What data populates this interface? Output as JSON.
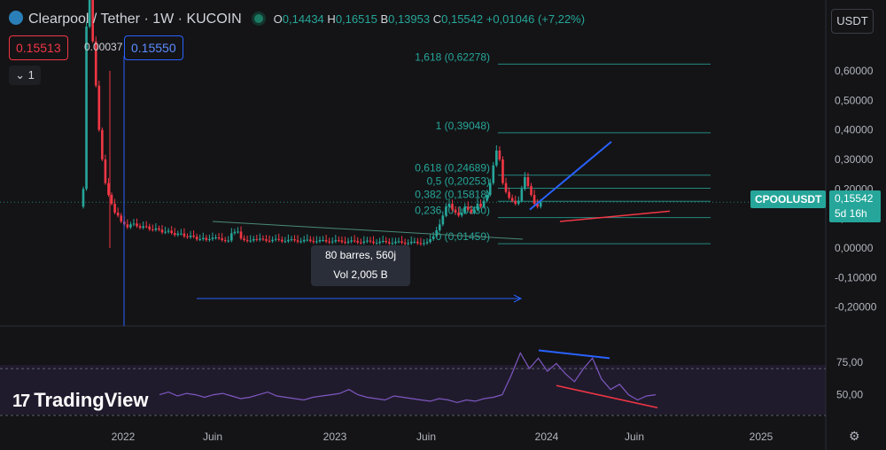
{
  "header": {
    "title": "Clearpool / Tether · 1W · KUCOIN",
    "o_label": "O",
    "o_value": "0,14434",
    "h_label": "H",
    "h_value": "0,16515",
    "l_label": "B",
    "l_value": "0,13953",
    "c_label": "C",
    "c_value": "0,15542",
    "change": "+0,01046 (+7,22%)"
  },
  "trade": {
    "sell": "0.15513",
    "spread": "0.00037",
    "buy": "0.15550"
  },
  "layout_count": "1",
  "currency": "USDT",
  "tooltip": {
    "line1": "80 barres, 560j",
    "line2": "Vol 2,005 B"
  },
  "price_tag": {
    "symbol": "CPOOLUSDT",
    "price": "0,15542",
    "countdown": "5d 16h"
  },
  "branding": {
    "logo": "TradingView"
  },
  "colors": {
    "up": "#26a69a",
    "down": "#f23645",
    "fib": "#26a69a",
    "trend_blue": "#2962ff",
    "rsi": "#7e57c2"
  },
  "chart_data": [
    {
      "type": "candlestick",
      "ylim": [
        -0.24,
        0.72
      ],
      "y_ticks": [
        "0,60000",
        "0,50000",
        "0,40000",
        "0,30000",
        "0,20000",
        "0,10000",
        "0,00000",
        "-0,10000",
        "-0,20000"
      ],
      "y_tick_values": [
        0.6,
        0.5,
        0.4,
        0.3,
        0.2,
        0.1,
        0.0,
        -0.1,
        -0.2
      ],
      "x_ticks": [
        "2022",
        "Juin",
        "2023",
        "Juin",
        "2024",
        "Juin",
        "2025"
      ],
      "fibonacci": [
        {
          "label": "1,618 (0,62278)",
          "value": 0.62278
        },
        {
          "label": "1 (0,39048)",
          "value": 0.39048
        },
        {
          "label": "0,618 (0,24689)",
          "value": 0.24689
        },
        {
          "label": "0,5 (0,20253)",
          "value": 0.20253
        },
        {
          "label": "0,382 (0,15818)",
          "value": 0.15818
        },
        {
          "label": "0,236 (0,10330)",
          "value": 0.1033
        },
        {
          "label": "0 (0,01459)",
          "value": 0.01459
        }
      ],
      "last_price": 0.15542
    },
    {
      "type": "line",
      "series": [
        {
          "name": "",
          "values": [
            50,
            52,
            49,
            51,
            50,
            48,
            50,
            51,
            49,
            47,
            48,
            50,
            52,
            49,
            48,
            47,
            46,
            48,
            49,
            50,
            51,
            54,
            50,
            48,
            47,
            46,
            49,
            48,
            47,
            46,
            45,
            47,
            46,
            44,
            46,
            45,
            47,
            48,
            50,
            65,
            82,
            70,
            78,
            68,
            74,
            66,
            60,
            70,
            78,
            62,
            54,
            58,
            50,
            46,
            49,
            50
          ]
        }
      ],
      "ylim": [
        30,
        100
      ],
      "y_ticks": [
        "75,00",
        "50,00"
      ],
      "y_tick_values": [
        75,
        50
      ]
    }
  ]
}
